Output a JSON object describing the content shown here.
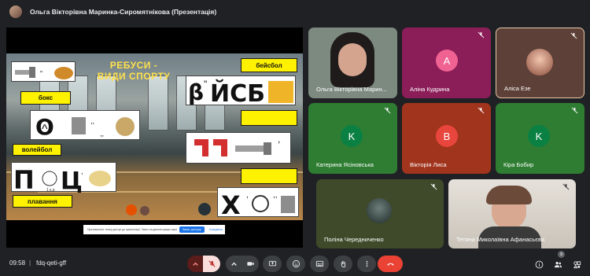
{
  "header": {
    "title": "Ольга Вікторівна Маринка-Сиромятнікова (Презентація)"
  },
  "slide": {
    "title_line1": "РЕБУСИ -",
    "title_line2": "ВИДИ СПОРТУ",
    "labels": {
      "boxing": "бокс",
      "volleyball": "волейбол",
      "swimming": "плавання",
      "baseball": "бейсбол"
    },
    "rebus1_text": "О, ,, ,,",
    "rebus2_text": "П  Ц",
    "rebus2_small": "1 к.р",
    "rebus3_text": "β\"ЙСБ",
    "rebus4_text": "Х",
    "notice": {
      "text": "Призначення: тепер доступ до презентації. Запит на демонстрацію екрана надіслано учасникам.",
      "primary": "Запит доступу",
      "secondary": "Скасувати"
    }
  },
  "participants": [
    {
      "name": "Ольга Вікторівна Марин...",
      "type": "video",
      "muted": false
    },
    {
      "name": "Аліна Кудрина",
      "initial": "A",
      "color": "#f06292",
      "bg": "#8b1e59",
      "muted": true
    },
    {
      "name": "Аліса Езе",
      "type": "photo",
      "bg": "#5d4037",
      "muted": true
    },
    {
      "name": "Катерина Ясіновська",
      "initial": "K",
      "color": "#0b8043",
      "bg": "#2e7d32",
      "muted": true
    },
    {
      "name": "Вікторія Лиса",
      "initial": "B",
      "color": "#e8453c",
      "bg": "#a0341d",
      "muted": true
    },
    {
      "name": "Кіра Бобир",
      "initial": "K",
      "color": "#0b8043",
      "bg": "#2e7d32",
      "muted": true
    },
    {
      "name": "Поліна Чередниченко",
      "type": "photo",
      "bg": "#3e4a2a",
      "muted": true
    },
    {
      "name": "Тетяна Миколаївна Афанасьєва",
      "type": "video",
      "muted": true
    }
  ],
  "bottom": {
    "time": "09:58",
    "separator": "|",
    "meeting_code": "fdq-qeti-gff",
    "people_count": "9"
  },
  "colors": {
    "accent_red": "#ea4335",
    "muted_red": "#f9dedc",
    "bar_bg": "#3c4043",
    "yellow": "#fff200"
  }
}
